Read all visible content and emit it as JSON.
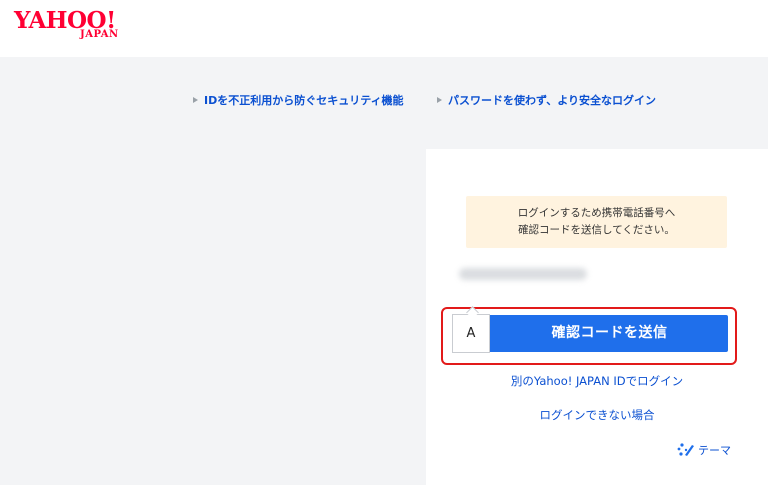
{
  "header": {
    "logo_text": "YAHOO!",
    "logo_sub": "JAPAN"
  },
  "links": {
    "security": "IDを不正利用から防ぐセキュリティ機能",
    "passwordless": "パスワードを使わず、より安全なログイン"
  },
  "login": {
    "notice_line1": "ログインするため携帯電話番号へ",
    "notice_line2": "確認コードを送信してください。",
    "send_button": "確認コードを送信",
    "keyboard_hint": "A",
    "other_id_link": "別のYahoo! JAPAN IDでログイン",
    "cannot_login_link": "ログインできない場合",
    "theme_link": "テーマ"
  },
  "colors": {
    "brand": "#ff0033",
    "link": "#0b50d1",
    "primary_button": "#1f6feb",
    "notice_bg": "#fff3df",
    "highlight_border": "#e21a1a"
  },
  "icons": {
    "link_bullet": "triangle-right-icon",
    "theme": "theme-palette-icon"
  }
}
